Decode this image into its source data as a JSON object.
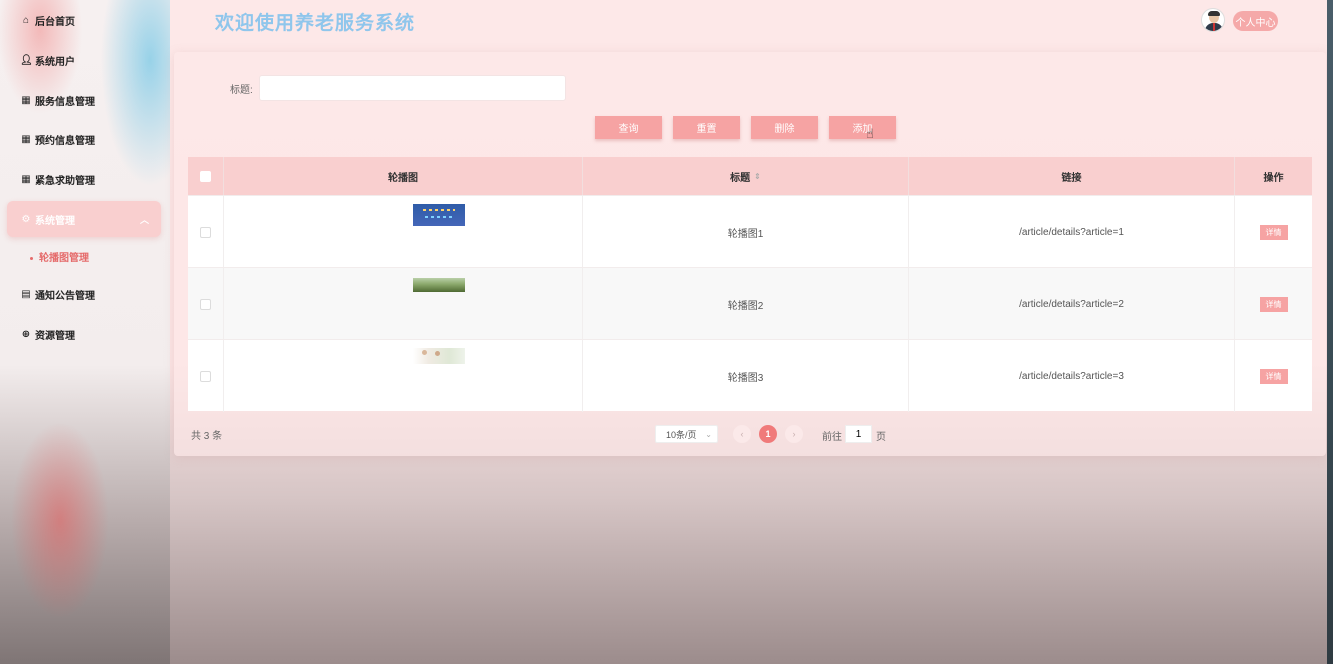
{
  "header": {
    "title": "欢迎使用养老服务系统",
    "user_center": "个人中心"
  },
  "sidebar": {
    "items": [
      {
        "label": "后台首页",
        "icon": "home-icon"
      },
      {
        "label": "系统用户",
        "icon": "user-icon"
      },
      {
        "label": "服务信息管理",
        "icon": "grid-icon"
      },
      {
        "label": "预约信息管理",
        "icon": "grid-icon"
      },
      {
        "label": "紧急求助管理",
        "icon": "grid-icon"
      },
      {
        "label": "系统管理",
        "icon": "gear-icon",
        "active": true
      },
      {
        "label": "通知公告管理",
        "icon": "document-icon"
      },
      {
        "label": "资源管理",
        "icon": "plus-circle-icon"
      }
    ],
    "subitem": {
      "label": "轮播图管理",
      "active": true
    }
  },
  "search": {
    "label": "标题:",
    "value": "",
    "placeholder": ""
  },
  "toolbar": {
    "query": "查询",
    "reset": "重置",
    "delete": "删除",
    "add": "添加"
  },
  "table": {
    "columns": [
      "轮播图",
      "标题",
      "链接",
      "操作"
    ],
    "rows": [
      {
        "title": "轮播图1",
        "link": "/article/details?article=1",
        "action": "详情"
      },
      {
        "title": "轮播图2",
        "link": "/article/details?article=2",
        "action": "详情"
      },
      {
        "title": "轮播图3",
        "link": "/article/details?article=3",
        "action": "详情"
      }
    ]
  },
  "pagination": {
    "total": "共 3 条",
    "page_size": "10条/页",
    "current_page": "1",
    "goto_label": "前往",
    "goto_value": "1",
    "page_unit": "页"
  },
  "colors": {
    "accent": "#f6a3a3",
    "header_title": "#8fc6ec",
    "active_page": "#f07a7a"
  }
}
